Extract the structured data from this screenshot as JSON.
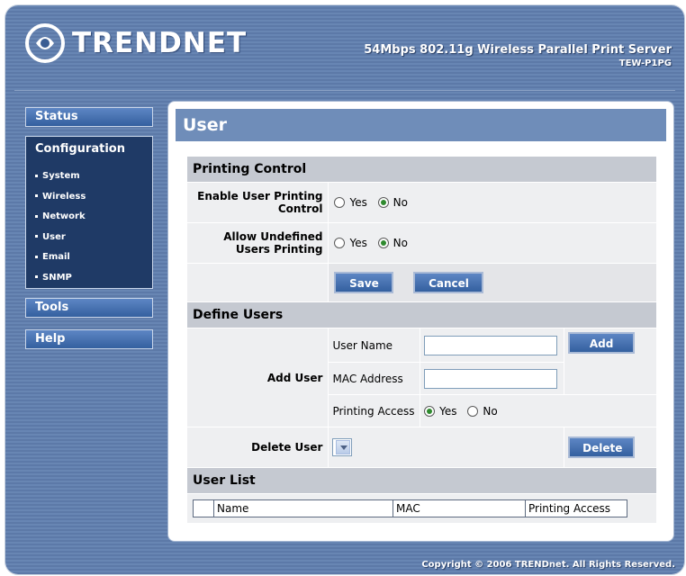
{
  "brand": {
    "name": "TRENDNET"
  },
  "product": {
    "title": "54Mbps 802.11g Wireless Parallel Print Server",
    "model": "TEW-P1PG"
  },
  "nav": {
    "status": "Status",
    "configuration": "Configuration",
    "config_items": [
      {
        "label": "System"
      },
      {
        "label": "Wireless"
      },
      {
        "label": "Network"
      },
      {
        "label": "User"
      },
      {
        "label": "Email"
      },
      {
        "label": "SNMP"
      }
    ],
    "tools": "Tools",
    "help": "Help"
  },
  "page": {
    "title": "User"
  },
  "printing_control": {
    "heading": "Printing Control",
    "enable_label": "Enable User Printing Control",
    "allow_label": "Allow Undefined Users Printing",
    "yes": "Yes",
    "no": "No",
    "enable_value": "No",
    "allow_value": "No",
    "save": "Save",
    "cancel": "Cancel"
  },
  "define_users": {
    "heading": "Define Users",
    "add_user_label": "Add User",
    "user_name_label": "User Name",
    "mac_label": "MAC Address",
    "access_label": "Printing Access",
    "access_value": "Yes",
    "yes": "Yes",
    "no": "No",
    "user_name_value": "",
    "mac_value": "",
    "add": "Add",
    "delete_user_label": "Delete User",
    "delete": "Delete"
  },
  "user_list": {
    "heading": "User List",
    "columns": [
      "Name",
      "MAC",
      "Printing Access"
    ]
  },
  "footer": {
    "copyright": "Copyright © 2006 TRENDnet. All Rights Reserved."
  }
}
